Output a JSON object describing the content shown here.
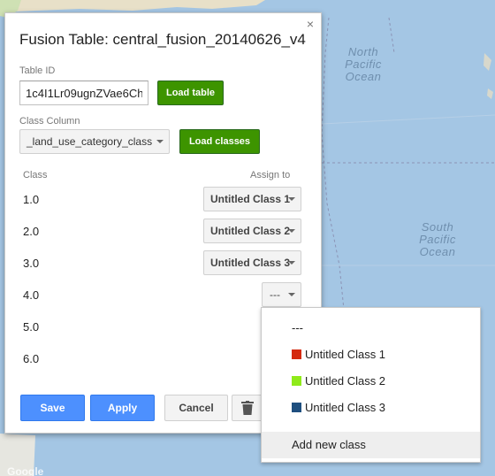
{
  "map": {
    "labels": {
      "north_pacific": [
        "North",
        "Pacific",
        "Ocean"
      ],
      "south_pacific": [
        "South",
        "Pacific",
        "Ocean"
      ]
    },
    "google_mark": "Google"
  },
  "panel": {
    "title": "Fusion Table: central_fusion_20140626_v4",
    "close_icon": "×",
    "table_id_label": "Table ID",
    "table_id_value": "1c4I1Lr09ugnZVae6Ch",
    "load_table_label": "Load table",
    "class_column_label": "Class Column",
    "class_column_value": "_land_use_category_class",
    "load_classes_label": "Load classes",
    "class_header": "Class",
    "assign_header": "Assign to",
    "rows": [
      {
        "class": "1.0",
        "assign": "Untitled Class 1"
      },
      {
        "class": "2.0",
        "assign": "Untitled Class 2"
      },
      {
        "class": "3.0",
        "assign": "Untitled Class 3"
      },
      {
        "class": "4.0",
        "assign": "---"
      },
      {
        "class": "5.0",
        "assign": ""
      },
      {
        "class": "6.0",
        "assign": ""
      }
    ],
    "save_label": "Save",
    "apply_label": "Apply",
    "cancel_label": "Cancel",
    "delete_icon": "trash-icon"
  },
  "dropdown": {
    "items": [
      {
        "label": "---",
        "color": ""
      },
      {
        "label": "Untitled Class 1",
        "color": "#d42a0f"
      },
      {
        "label": "Untitled Class 2",
        "color": "#8fea1a"
      },
      {
        "label": "Untitled Class 3",
        "color": "#1f4f7f"
      },
      {
        "label": "Add new class",
        "color": "",
        "highlighted": true
      }
    ]
  }
}
